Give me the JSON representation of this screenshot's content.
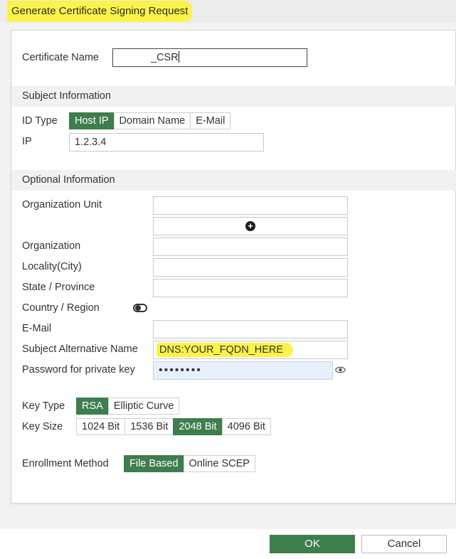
{
  "dialog": {
    "title": "Generate Certificate Signing Request"
  },
  "certificate_name": {
    "label": "Certificate Name",
    "value": "_CSR"
  },
  "subject": {
    "heading": "Subject Information",
    "id_type": {
      "label": "ID Type",
      "options": [
        "Host IP",
        "Domain Name",
        "E-Mail"
      ],
      "selected": "Host IP"
    },
    "ip": {
      "label": "IP",
      "value": "1.2.3.4"
    }
  },
  "optional": {
    "heading": "Optional Information",
    "org_unit_label": "Organization Unit",
    "organization_label": "Organization",
    "locality_label": "Locality(City)",
    "state_label": "State / Province",
    "country_label": "Country / Region",
    "email_label": "E-Mail",
    "san": {
      "label": "Subject Alternative Name",
      "value": "DNS:YOUR_FQDN_HERE"
    },
    "password": {
      "label": "Password for private key",
      "value": "••••••••"
    }
  },
  "key": {
    "type_label": "Key Type",
    "type_options": [
      "RSA",
      "Elliptic Curve"
    ],
    "type_selected": "RSA",
    "size_label": "Key Size",
    "size_options": [
      "1024 Bit",
      "1536 Bit",
      "2048 Bit",
      "4096 Bit"
    ],
    "size_selected": "2048 Bit"
  },
  "enrollment": {
    "label": "Enrollment Method",
    "options": [
      "File Based",
      "Online SCEP"
    ],
    "selected": "File Based"
  },
  "footer": {
    "ok_label": "OK",
    "cancel_label": "Cancel"
  },
  "colors": {
    "accent_green": "#3e7d4c",
    "highlight_yellow": "#fbf34a",
    "autofill_blue": "#e8f0fe"
  }
}
